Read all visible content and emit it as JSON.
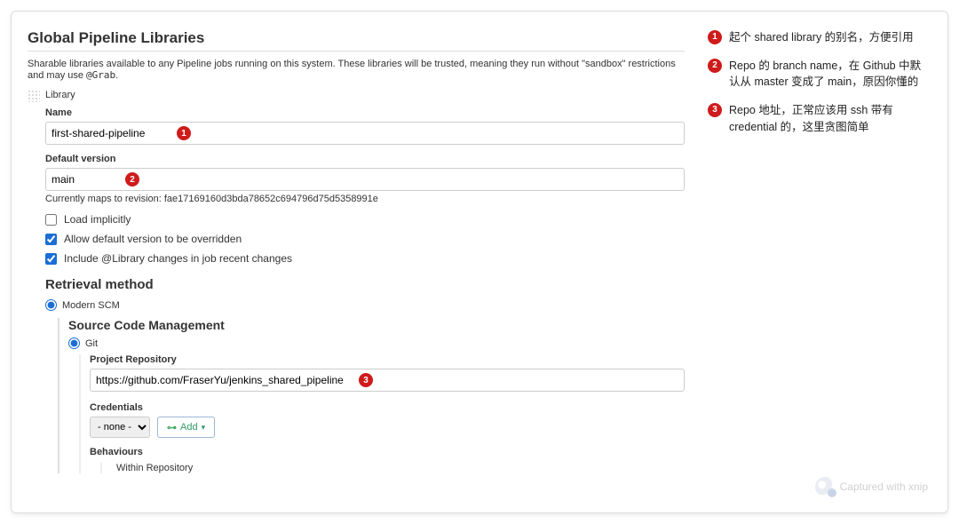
{
  "header": {
    "title": "Global Pipeline Libraries",
    "description_pre": "Sharable libraries available to any Pipeline jobs running on this system. These libraries will be trusted, meaning they run without \"sandbox\" restrictions and may use ",
    "description_code": "@Grab",
    "description_post": "."
  },
  "library": {
    "section_label": "Library",
    "name_label": "Name",
    "name_value": "first-shared-pipeline",
    "default_version_label": "Default version",
    "default_version_value": "main",
    "revision_hint": "Currently maps to revision: fae17169160d3bda78652c694796d75d5358991e",
    "checks": {
      "load_implicitly": {
        "label": "Load implicitly",
        "checked": false
      },
      "allow_override": {
        "label": "Allow default version to be overridden",
        "checked": true
      },
      "include_changes": {
        "label": "Include @Library changes in job recent changes",
        "checked": true
      }
    }
  },
  "retrieval": {
    "heading": "Retrieval method",
    "modern_scm_label": "Modern SCM",
    "scm_heading": "Source Code Management",
    "git_label": "Git",
    "project_repo_label": "Project Repository",
    "project_repo_value": "https://github.com/FraserYu/jenkins_shared_pipeline",
    "credentials_label": "Credentials",
    "credentials_selected": "- none -",
    "add_button_label": "Add",
    "behaviours_label": "Behaviours",
    "behaviours_sub": "Within Repository"
  },
  "badges": {
    "b1": "1",
    "b2": "2",
    "b3": "3"
  },
  "annotations": {
    "a1": "起个 shared library 的别名，方便引用",
    "a2": "Repo 的 branch name，在 Github 中默认从 master 变成了 main，原因你懂的",
    "a3": "Repo 地址，正常应该用 ssh 带有 credential 的，这里贪图简单"
  },
  "watermark": {
    "text": "Captured with xnip"
  }
}
